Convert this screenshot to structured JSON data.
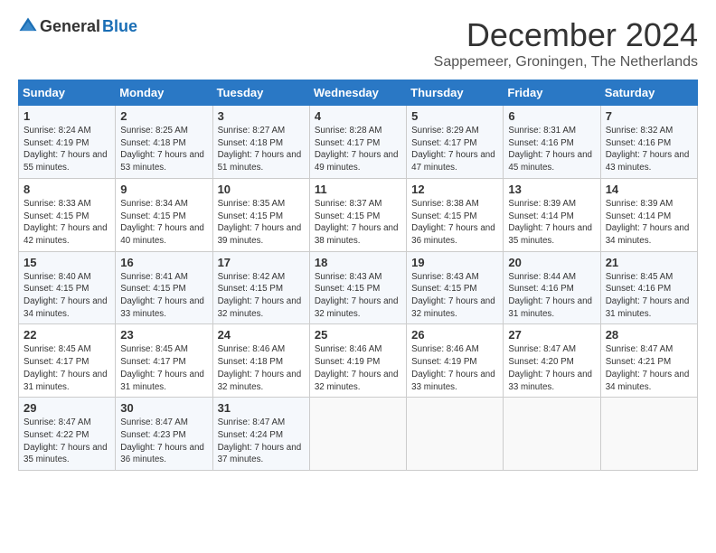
{
  "header": {
    "logo_general": "General",
    "logo_blue": "Blue",
    "month_title": "December 2024",
    "subtitle": "Sappemeer, Groningen, The Netherlands"
  },
  "weekdays": [
    "Sunday",
    "Monday",
    "Tuesday",
    "Wednesday",
    "Thursday",
    "Friday",
    "Saturday"
  ],
  "weeks": [
    [
      {
        "day": "1",
        "sunrise": "8:24 AM",
        "sunset": "4:19 PM",
        "daylight": "7 hours and 55 minutes."
      },
      {
        "day": "2",
        "sunrise": "8:25 AM",
        "sunset": "4:18 PM",
        "daylight": "7 hours and 53 minutes."
      },
      {
        "day": "3",
        "sunrise": "8:27 AM",
        "sunset": "4:18 PM",
        "daylight": "7 hours and 51 minutes."
      },
      {
        "day": "4",
        "sunrise": "8:28 AM",
        "sunset": "4:17 PM",
        "daylight": "7 hours and 49 minutes."
      },
      {
        "day": "5",
        "sunrise": "8:29 AM",
        "sunset": "4:17 PM",
        "daylight": "7 hours and 47 minutes."
      },
      {
        "day": "6",
        "sunrise": "8:31 AM",
        "sunset": "4:16 PM",
        "daylight": "7 hours and 45 minutes."
      },
      {
        "day": "7",
        "sunrise": "8:32 AM",
        "sunset": "4:16 PM",
        "daylight": "7 hours and 43 minutes."
      }
    ],
    [
      {
        "day": "8",
        "sunrise": "8:33 AM",
        "sunset": "4:15 PM",
        "daylight": "7 hours and 42 minutes."
      },
      {
        "day": "9",
        "sunrise": "8:34 AM",
        "sunset": "4:15 PM",
        "daylight": "7 hours and 40 minutes."
      },
      {
        "day": "10",
        "sunrise": "8:35 AM",
        "sunset": "4:15 PM",
        "daylight": "7 hours and 39 minutes."
      },
      {
        "day": "11",
        "sunrise": "8:37 AM",
        "sunset": "4:15 PM",
        "daylight": "7 hours and 38 minutes."
      },
      {
        "day": "12",
        "sunrise": "8:38 AM",
        "sunset": "4:15 PM",
        "daylight": "7 hours and 36 minutes."
      },
      {
        "day": "13",
        "sunrise": "8:39 AM",
        "sunset": "4:14 PM",
        "daylight": "7 hours and 35 minutes."
      },
      {
        "day": "14",
        "sunrise": "8:39 AM",
        "sunset": "4:14 PM",
        "daylight": "7 hours and 34 minutes."
      }
    ],
    [
      {
        "day": "15",
        "sunrise": "8:40 AM",
        "sunset": "4:15 PM",
        "daylight": "7 hours and 34 minutes."
      },
      {
        "day": "16",
        "sunrise": "8:41 AM",
        "sunset": "4:15 PM",
        "daylight": "7 hours and 33 minutes."
      },
      {
        "day": "17",
        "sunrise": "8:42 AM",
        "sunset": "4:15 PM",
        "daylight": "7 hours and 32 minutes."
      },
      {
        "day": "18",
        "sunrise": "8:43 AM",
        "sunset": "4:15 PM",
        "daylight": "7 hours and 32 minutes."
      },
      {
        "day": "19",
        "sunrise": "8:43 AM",
        "sunset": "4:15 PM",
        "daylight": "7 hours and 32 minutes."
      },
      {
        "day": "20",
        "sunrise": "8:44 AM",
        "sunset": "4:16 PM",
        "daylight": "7 hours and 31 minutes."
      },
      {
        "day": "21",
        "sunrise": "8:45 AM",
        "sunset": "4:16 PM",
        "daylight": "7 hours and 31 minutes."
      }
    ],
    [
      {
        "day": "22",
        "sunrise": "8:45 AM",
        "sunset": "4:17 PM",
        "daylight": "7 hours and 31 minutes."
      },
      {
        "day": "23",
        "sunrise": "8:45 AM",
        "sunset": "4:17 PM",
        "daylight": "7 hours and 31 minutes."
      },
      {
        "day": "24",
        "sunrise": "8:46 AM",
        "sunset": "4:18 PM",
        "daylight": "7 hours and 32 minutes."
      },
      {
        "day": "25",
        "sunrise": "8:46 AM",
        "sunset": "4:19 PM",
        "daylight": "7 hours and 32 minutes."
      },
      {
        "day": "26",
        "sunrise": "8:46 AM",
        "sunset": "4:19 PM",
        "daylight": "7 hours and 33 minutes."
      },
      {
        "day": "27",
        "sunrise": "8:47 AM",
        "sunset": "4:20 PM",
        "daylight": "7 hours and 33 minutes."
      },
      {
        "day": "28",
        "sunrise": "8:47 AM",
        "sunset": "4:21 PM",
        "daylight": "7 hours and 34 minutes."
      }
    ],
    [
      {
        "day": "29",
        "sunrise": "8:47 AM",
        "sunset": "4:22 PM",
        "daylight": "7 hours and 35 minutes."
      },
      {
        "day": "30",
        "sunrise": "8:47 AM",
        "sunset": "4:23 PM",
        "daylight": "7 hours and 36 minutes."
      },
      {
        "day": "31",
        "sunrise": "8:47 AM",
        "sunset": "4:24 PM",
        "daylight": "7 hours and 37 minutes."
      },
      null,
      null,
      null,
      null
    ]
  ],
  "labels": {
    "sunrise": "Sunrise:",
    "sunset": "Sunset:",
    "daylight": "Daylight:"
  }
}
